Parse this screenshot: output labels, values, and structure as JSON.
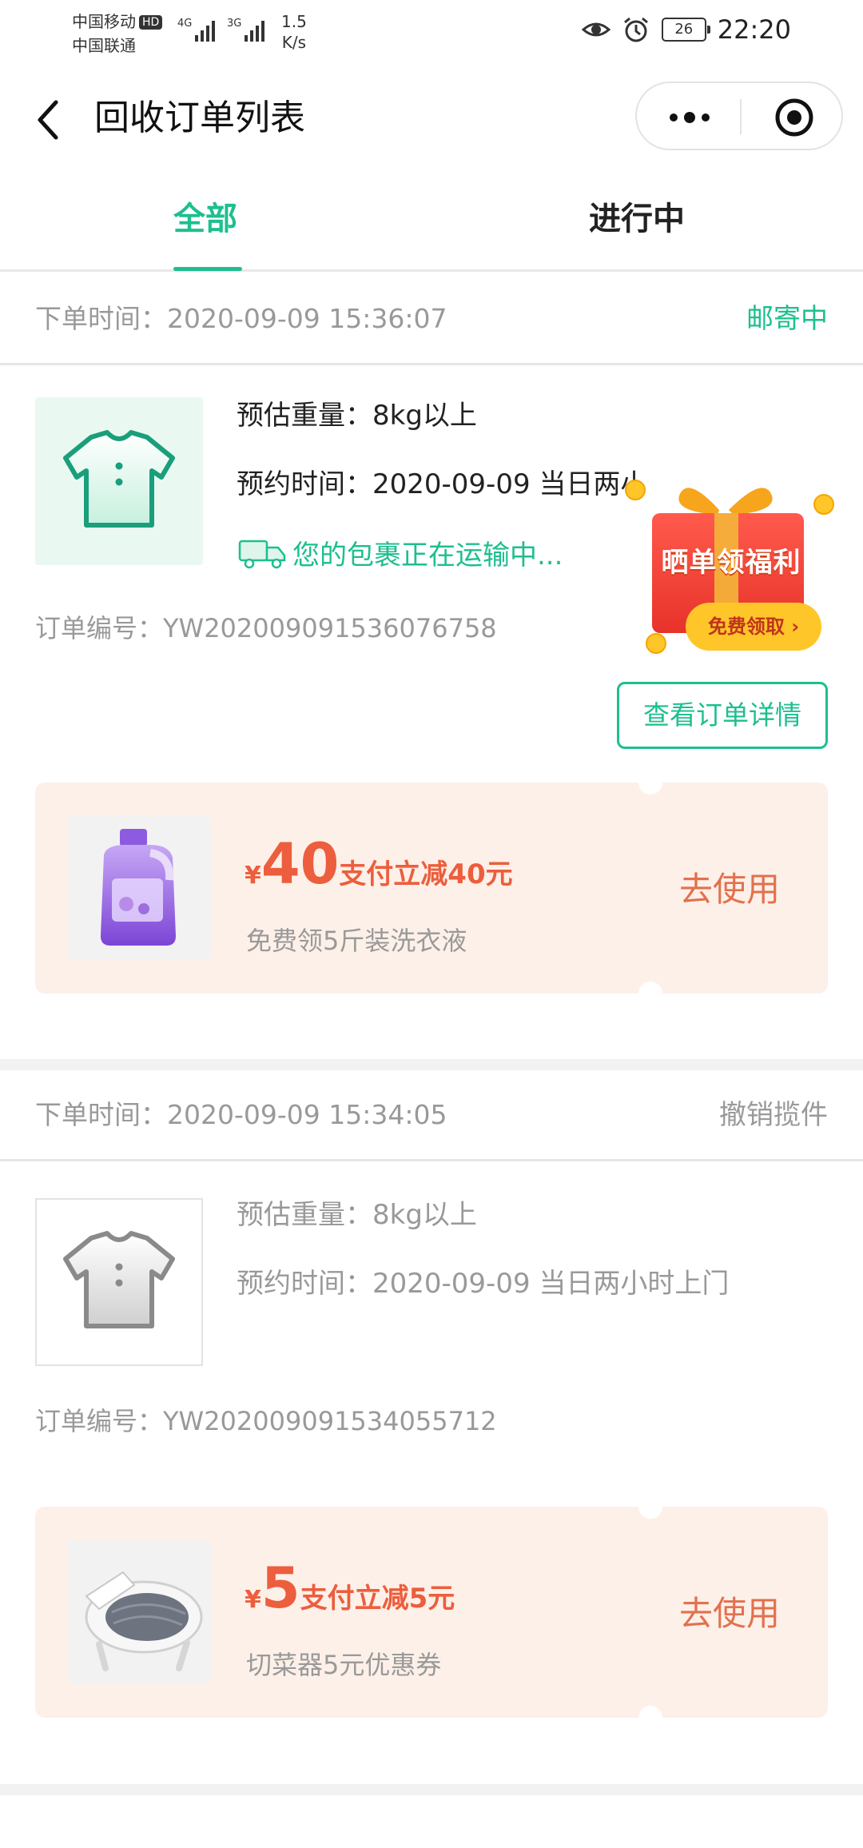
{
  "status_bar": {
    "carrier1": "中国移动",
    "hd": "HD",
    "carrier2": "中国联通",
    "sig1": "4G",
    "sig2": "3G",
    "net_speed_value": "1.5",
    "net_speed_unit": "K/s",
    "battery": "26",
    "time": "22:20"
  },
  "nav": {
    "title": "回收订单列表"
  },
  "tabs": [
    {
      "label": "全部",
      "active": true
    },
    {
      "label": "进行中",
      "active": false
    }
  ],
  "orders": [
    {
      "time_label": "下单时间：",
      "time": "2020-09-09 15:36:07",
      "status": "邮寄中",
      "weight": "预估重量：8kg以上",
      "appointment": "预约时间：2020-09-09 当日两小时上",
      "shipping": "您的包裹正在运输中...",
      "order_no": "订单编号：YW202009091536076758",
      "detail_button": "查看订单详情",
      "coupon": {
        "yen": "¥",
        "amount": "40",
        "desc": "支付立减40元",
        "sub": "免费领5斤装洗衣液",
        "use": "去使用"
      }
    },
    {
      "time_label": "下单时间：",
      "time": "2020-09-09 15:34:05",
      "status": "撤销揽件",
      "weight": "预估重量：8kg以上",
      "appointment": "预约时间：2020-09-09 当日两小时上门",
      "order_no": "订单编号：YW202009091534055712",
      "coupon": {
        "yen": "¥",
        "amount": "5",
        "desc": "支付立减5元",
        "sub": "切菜器5元优惠券",
        "use": "去使用"
      }
    }
  ],
  "gift": {
    "title": "晒单领福利",
    "button": "免费领取 ›"
  },
  "colors": {
    "accent": "#1dbf8f",
    "coupon_red": "#ec5e3d",
    "coupon_bg": "#fdf0e8",
    "muted": "#999999"
  }
}
